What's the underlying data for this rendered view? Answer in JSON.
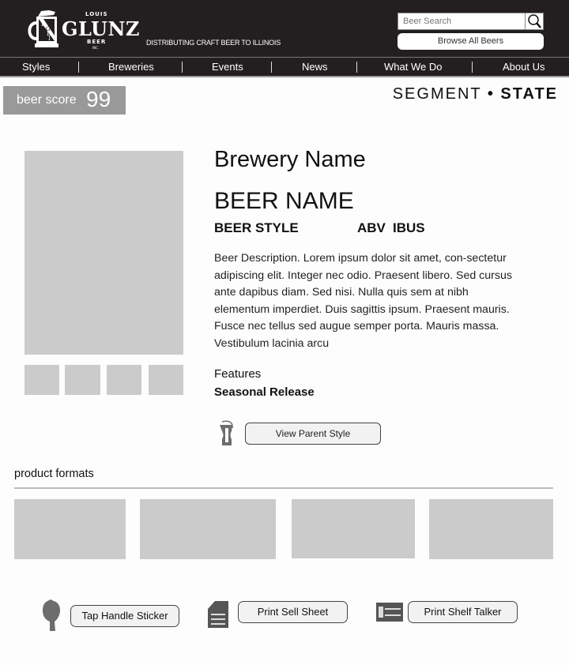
{
  "header": {
    "logo": {
      "top_text": "LOUIS",
      "main_text": "GLUNZ",
      "bottom_text": "BEER",
      "sub_text": "INC.",
      "emblem_letters": [
        "L",
        "G",
        "B",
        "I"
      ]
    },
    "tagline": "DISTRIBUTING CRAFT BEER TO ILLINOIS",
    "search": {
      "placeholder": "Beer Search",
      "value": ""
    },
    "browse_label": "Browse All Beers"
  },
  "nav": {
    "items": [
      {
        "label": "Styles"
      },
      {
        "label": "Breweries"
      },
      {
        "label": "Events"
      },
      {
        "label": "News"
      },
      {
        "label": "What We Do"
      },
      {
        "label": "About Us"
      }
    ]
  },
  "score": {
    "label": "beer score",
    "value": "99"
  },
  "segment": {
    "segment": "SEGMENT",
    "separator": "•",
    "state": "STATE"
  },
  "beer": {
    "brewery": "Brewery Name",
    "name": "BEER NAME",
    "style": "BEER STYLE",
    "abv": "ABV",
    "ibus": "IBUS",
    "description": "Beer Description. Lorem ipsum dolor sit amet, con-sectetur adipiscing elit. Integer nec odio. Praesent libero. Sed cursus ante dapibus diam. Sed nisi. Nulla quis sem at nibh elementum imperdiet. Duis sagittis ipsum. Praesent mauris. Fusce nec tellus sed augue semper porta. Mauris massa. Vestibulum lacinia arcu",
    "features_label": "Features",
    "features_value": "Seasonal Release",
    "parent_style_label": "View Parent Style"
  },
  "product_formats": {
    "label": "product formats",
    "count": 4
  },
  "actions": {
    "tap_handle": "Tap Handle Sticker",
    "sell_sheet": "Print Sell Sheet",
    "shelf_talker": "Print Shelf Talker"
  },
  "colors": {
    "header_bg": "#231f20",
    "placeholder_gray": "#cbcbcb",
    "score_bg": "#999999",
    "icon_gray": "#6d6d6d"
  }
}
